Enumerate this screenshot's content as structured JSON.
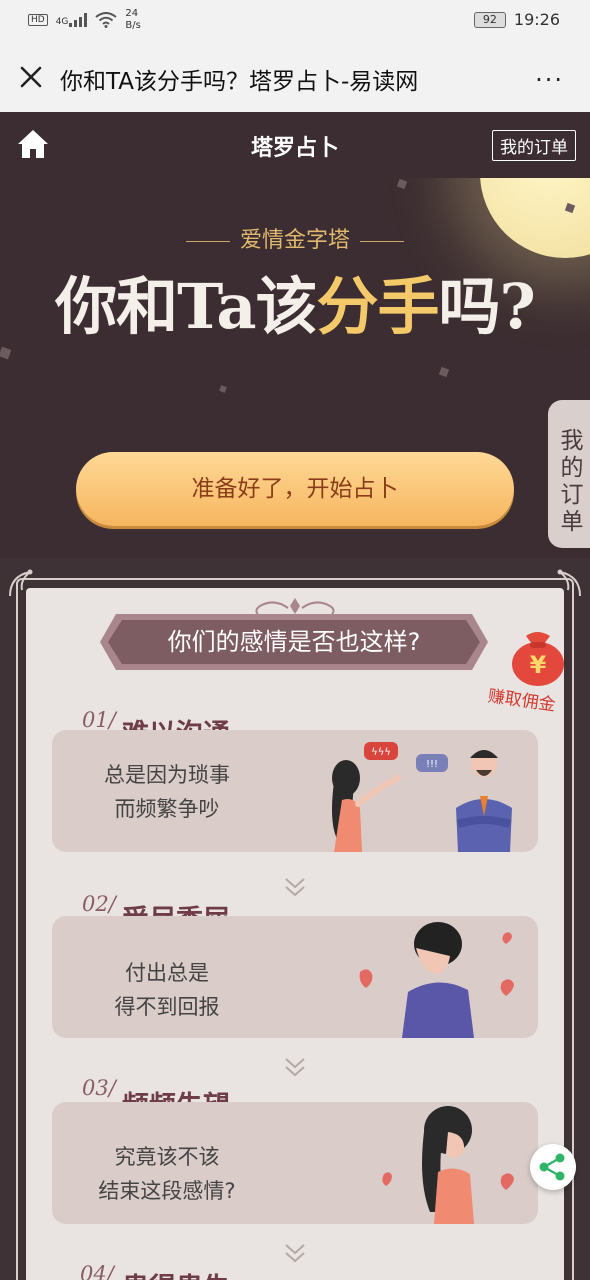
{
  "status_bar": {
    "hd": "HD",
    "network": "4G",
    "speed_value": "24",
    "speed_unit": "B/s",
    "battery": "92",
    "time": "19:26"
  },
  "browser": {
    "title": "你和TA该分手吗？塔罗占卜-易读网",
    "more": "···"
  },
  "app_header": {
    "title": "塔罗占卜",
    "orders_button": "我的订单"
  },
  "hero": {
    "subtitle": "爱情金字塔",
    "title_part1": "你和Ta该",
    "title_highlight": "分手",
    "title_part2": "吗?",
    "start_button": "准备好了，开始占卜"
  },
  "side_tab": {
    "label": "我的订单"
  },
  "panel": {
    "banner": "你们的感情是否也这样?",
    "commission": "赚取佣金",
    "items": [
      {
        "num": "01/",
        "title": "难以沟通",
        "line1": "总是因为琐事",
        "line2": "而频繁争吵"
      },
      {
        "num": "02/",
        "title": "受尽委屈",
        "line1": "付出总是",
        "line2": "得不到回报"
      },
      {
        "num": "03/",
        "title": "频频失望",
        "line1": "究竟该不该",
        "line2": "结束这段感情?"
      },
      {
        "num": "04/",
        "title": "患得患失"
      }
    ]
  },
  "colors": {
    "dark_bg": "#3b2d31",
    "gold": "#f3c96a",
    "button": "#f6b55f",
    "panel": "#e9e4e1",
    "accent": "#7d5c62"
  }
}
